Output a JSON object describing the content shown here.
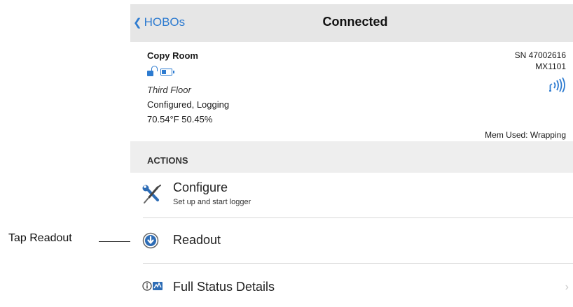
{
  "callout": {
    "label": "Tap Readout"
  },
  "nav": {
    "back_label": "HOBOs",
    "title": "Connected"
  },
  "device": {
    "name": "Copy Room",
    "location": "Third Floor",
    "status": "Configured, Logging",
    "reading": "70.54°F  50.45%",
    "serial": "SN 47002616",
    "model": "MX1101",
    "memory": "Mem Used: Wrapping",
    "icons": [
      "unlock-icon",
      "battery-icon",
      "bluetooth-signal-icon"
    ]
  },
  "actions": {
    "header": "ACTIONS",
    "items": [
      {
        "title": "Configure",
        "subtitle": "Set up and start logger",
        "icon": "wrench-screwdriver-icon"
      },
      {
        "title": "Readout",
        "icon": "download-arrow-icon"
      },
      {
        "title": "Full Status Details",
        "icon": "info-status-icon",
        "chevron": "›"
      }
    ]
  },
  "colors": {
    "accent": "#2d7bd0",
    "navbar": "#e6e6e6",
    "section": "#eeeeee"
  }
}
